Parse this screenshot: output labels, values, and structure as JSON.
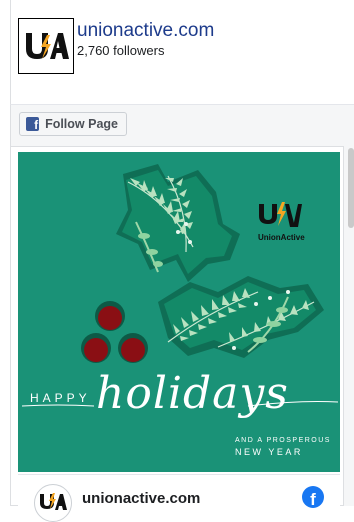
{
  "page": {
    "name": "unionactive.com",
    "followers": "2,760 followers"
  },
  "follow_button": {
    "label": "Follow Page",
    "icon": "facebook-icon"
  },
  "post": {
    "image": {
      "brand": "UnionActive",
      "line1": "HAPPY",
      "line2": "holidays",
      "line3": "AND A PROSPEROUS",
      "line4": "NEW YEAR"
    },
    "footer": {
      "name": "unionactive.com"
    }
  },
  "colors": {
    "accent": "#1d3b8b",
    "card_green": "#1a9277",
    "facebook_blue": "#1877f2",
    "berry_red": "#8a0f14",
    "logo_orange": "#f5a623"
  }
}
